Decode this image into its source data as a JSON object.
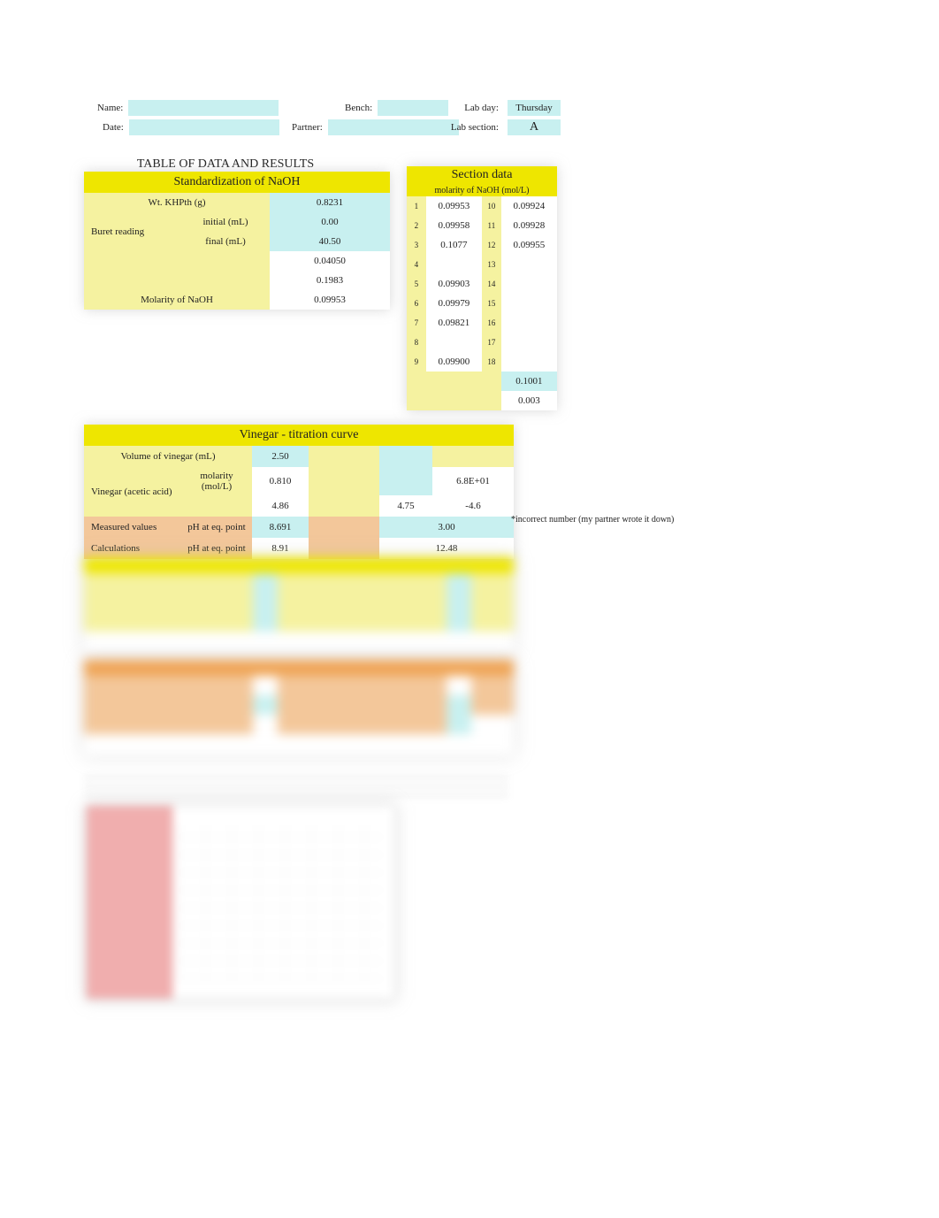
{
  "header": {
    "name_label": "Name:",
    "date_label": "Date:",
    "bench_label": "Bench:",
    "partner_label": "Partner:",
    "labday_label": "Lab day:",
    "labsection_label": "Lab section:",
    "labday_value": "Thursday",
    "labsection_value": "A"
  },
  "title": "TABLE OF DATA AND RESULTS",
  "std": {
    "header": "Standardization of NaOH",
    "rows": {
      "wt_label": "Wt. KHPth (g)",
      "wt_val": "0.8231",
      "buret_label": "Buret reading",
      "initial_label": "initial (mL)",
      "initial_val": "0.00",
      "final_label": "final (mL)",
      "final_val": "40.50",
      "blank1": "0.04050",
      "blank2": "0.1983",
      "mol_label": "Molarity of NaOH",
      "mol_val": "0.09953"
    }
  },
  "section": {
    "header": "Section data",
    "sub": "molarity of NaOH (mol/L)",
    "left_idx": [
      "1",
      "2",
      "3",
      "4",
      "5",
      "6",
      "7",
      "8",
      "9"
    ],
    "left_val": [
      "0.09953",
      "0.09958",
      "0.1077",
      "",
      "0.09903",
      "0.09979",
      "0.09821",
      "",
      "0.09900"
    ],
    "right_idx": [
      "10",
      "11",
      "12",
      "13",
      "14",
      "15",
      "16",
      "17",
      "18"
    ],
    "right_val": [
      "0.09924",
      "0.09928",
      "0.09955",
      "",
      "",
      "",
      "",
      "",
      ""
    ],
    "avg": "0.1001",
    "sd": "0.003"
  },
  "vinegar": {
    "header": "Vinegar - titration curve",
    "vol_label": "Volume of vinegar (mL)",
    "vol_val": "2.50",
    "acid_label": "Vinegar (acetic acid)",
    "molarity_label": "molarity (mol/L)",
    "molarity_val": "0.810",
    "row3_a": "4.86",
    "row3_b": "4.75",
    "exp_b": "6.8E+01",
    "exp_c": "-4.6",
    "measured_label": "Measured values",
    "ph_label": "pH at eq. point",
    "measured_ph": "8.691",
    "measured_right": "3.00",
    "calc_label": "Calculations",
    "calc_ph": "8.91",
    "calc_right": "12.48",
    "note": "*incorrect number (my partner wrote it down)"
  }
}
